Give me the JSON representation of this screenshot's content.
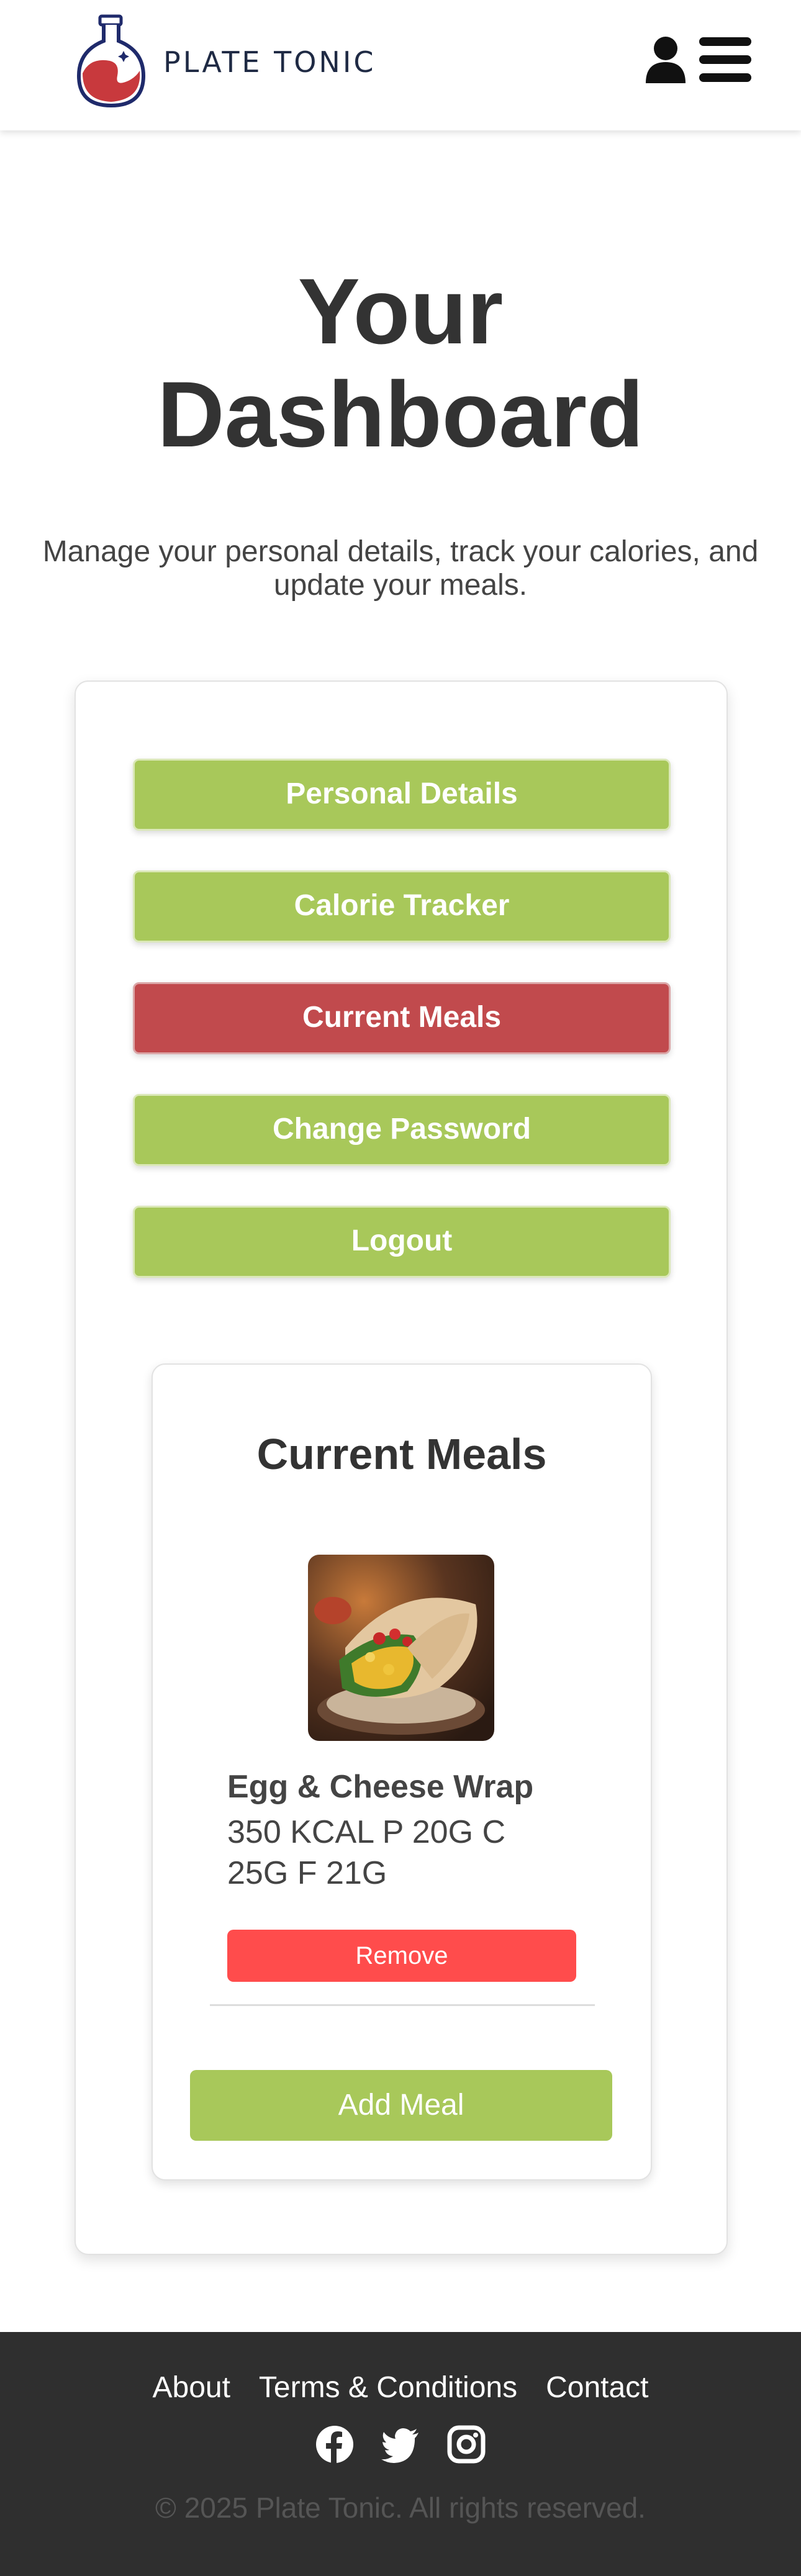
{
  "header": {
    "logo_text": "PLATE TONIC",
    "icons": [
      "user-icon",
      "hamburger-menu-icon"
    ]
  },
  "hero": {
    "title_line1": "Your",
    "title_line2": "Dashboard",
    "subtitle_line1": "Manage your personal details, track your calories, and",
    "subtitle_line2": "update your meals."
  },
  "nav": {
    "items": [
      {
        "label": "Personal Details",
        "active": false
      },
      {
        "label": "Calorie Tracker",
        "active": false
      },
      {
        "label": "Current Meals",
        "active": true
      },
      {
        "label": "Change Password",
        "active": false
      },
      {
        "label": "Logout",
        "active": false
      }
    ]
  },
  "meals": {
    "title": "Current Meals",
    "items": [
      {
        "name": "Egg & Cheese Wrap",
        "macros_line1": "350 KCAL P 20G C",
        "macros_line2": "25G F 21G",
        "remove_label": "Remove"
      }
    ],
    "add_label": "Add Meal"
  },
  "footer": {
    "links": [
      "About",
      "Terms & Conditions",
      "Contact"
    ],
    "social": [
      "facebook-icon",
      "twitter-icon",
      "instagram-icon"
    ],
    "copyright": "© 2025 Plate Tonic. All rights reserved."
  },
  "colors": {
    "accent_green": "#a8c85a",
    "active_red": "#c14a4d",
    "remove_red": "#ff4c4c",
    "footer_bg": "#2f2f2f",
    "text_dark": "#333333"
  }
}
